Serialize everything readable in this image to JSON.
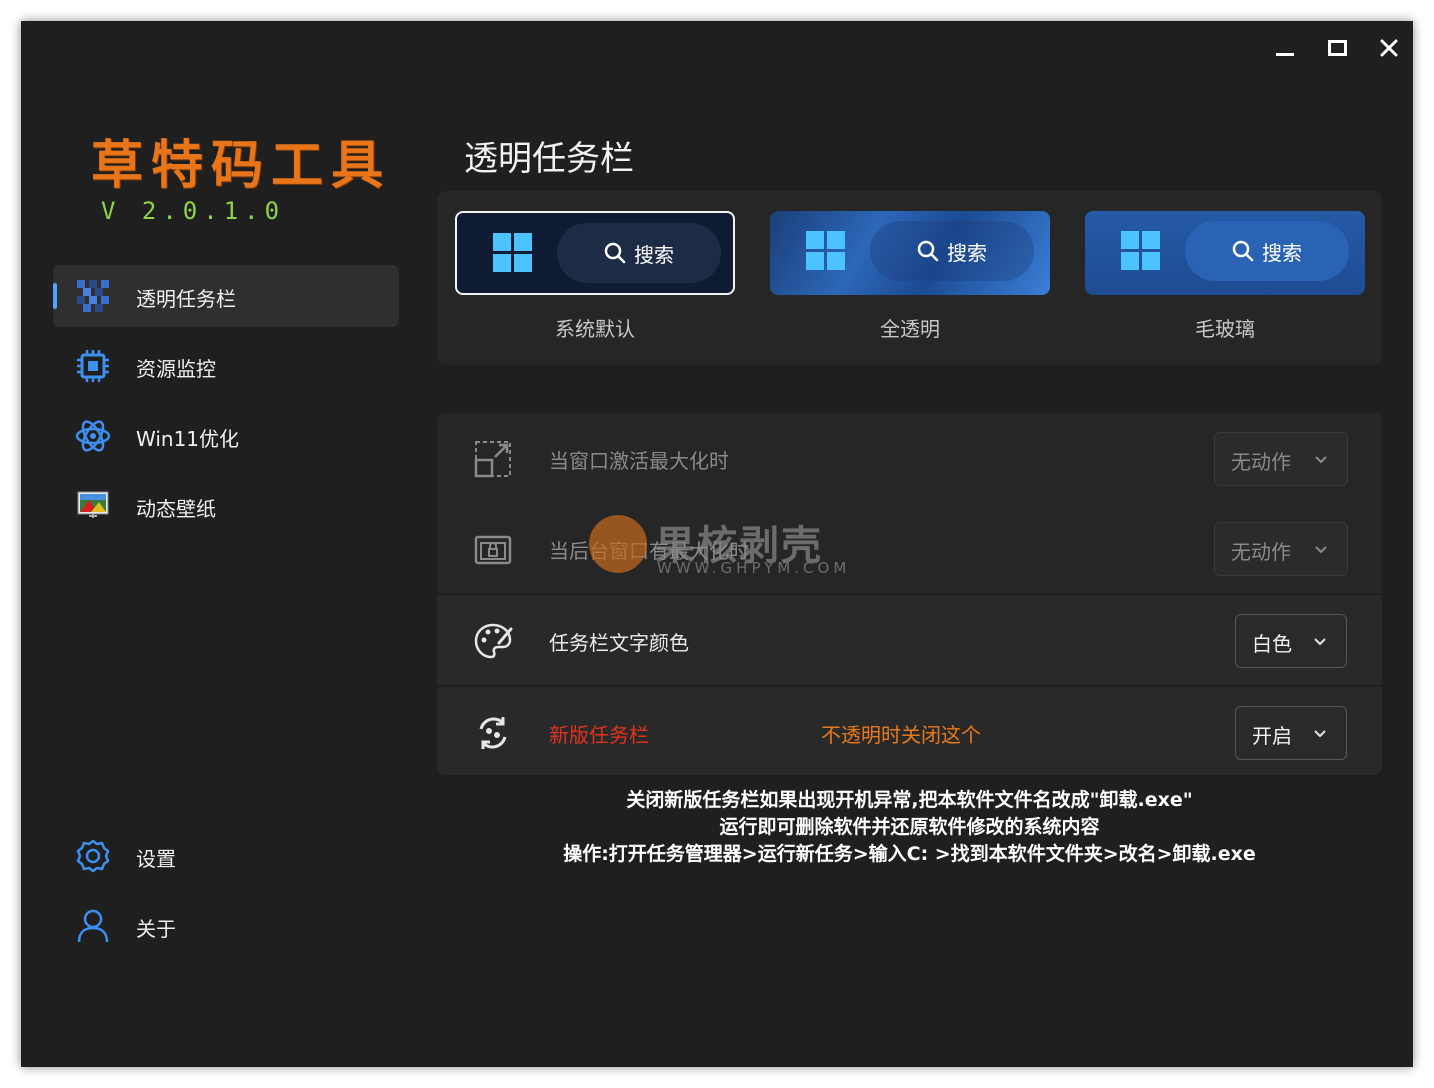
{
  "app": {
    "brand": "草特码工具",
    "version": "V 2.0.1.0"
  },
  "window_controls": {
    "minimize": "minimize-icon",
    "maximize": "maximize-icon",
    "close": "✕"
  },
  "sidebar": {
    "items": [
      {
        "label": "透明任务栏",
        "icon": "transparent-taskbar-icon",
        "active": true
      },
      {
        "label": "资源监控",
        "icon": "cpu-chip-icon"
      },
      {
        "label": "Win11优化",
        "icon": "atom-icon"
      },
      {
        "label": "动态壁纸",
        "icon": "wallpaper-icon"
      }
    ],
    "bottom_items": [
      {
        "label": "设置",
        "icon": "gear-icon"
      },
      {
        "label": "关于",
        "icon": "user-icon"
      }
    ]
  },
  "main": {
    "title": "透明任务栏",
    "styles": [
      {
        "label": "系统默认",
        "search": "搜索",
        "selected": true
      },
      {
        "label": "全透明",
        "search": "搜索"
      },
      {
        "label": "毛玻璃",
        "search": "搜索"
      }
    ],
    "settings": [
      {
        "label": "当窗口激活最大化时",
        "value": "无动作",
        "icon": "maximize-window-icon",
        "disabled": true
      },
      {
        "label": "当后台窗口有最大化时",
        "value": "无动作",
        "icon": "background-window-icon",
        "disabled": true
      },
      {
        "label": "任务栏文字颜色",
        "value": "白色",
        "icon": "palette-icon"
      },
      {
        "label": "新版任务栏",
        "hint": "不透明时关闭这个",
        "value": "开启",
        "icon": "refresh-icon"
      }
    ],
    "notes": [
      "关闭新版任务栏如果出现开机异常,把本软件文件名改成\"卸载.exe\"",
      "运行即可删除软件并还原软件修改的系统内容",
      "操作:打开任务管理器>运行新任务>输入C: >找到本软件文件夹>改名>卸载.exe"
    ]
  },
  "watermark": {
    "cn": "果核剥壳",
    "en": "WWW.GHPYM.COM"
  },
  "colors": {
    "brand": "#e8751a",
    "version": "#8ed34a",
    "accent": "#4aa3ff",
    "warning_red": "#e0321e",
    "warning_orange": "#e87a1a"
  }
}
